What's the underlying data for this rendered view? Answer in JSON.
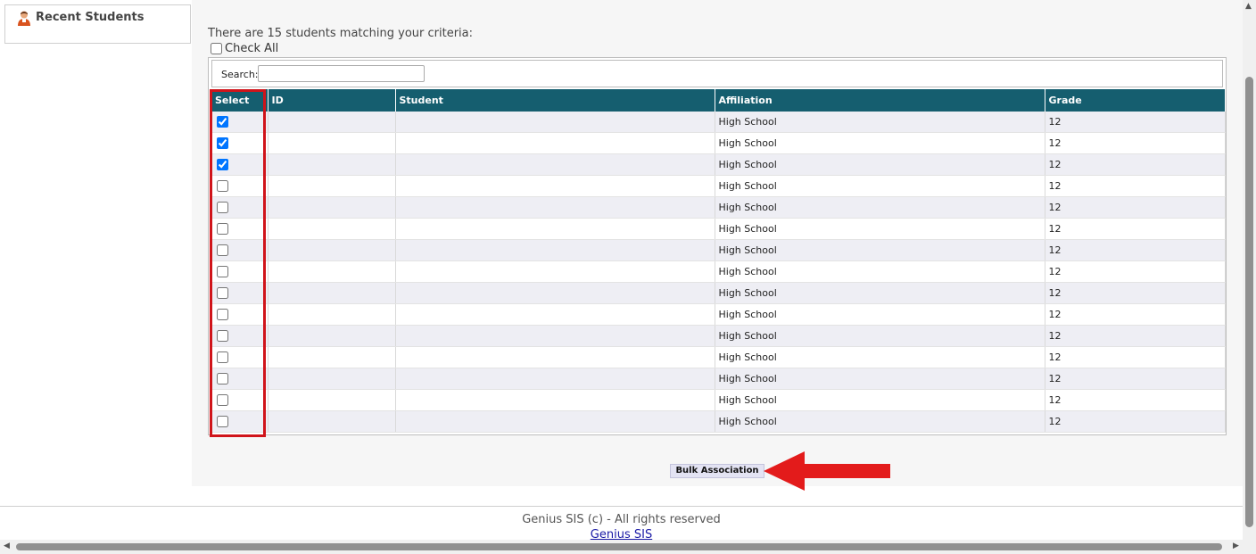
{
  "sidebar": {
    "recent_title": "Recent Students",
    "icon": "student-avatar-icon"
  },
  "main": {
    "match_text": "There are 15 students matching your criteria:",
    "check_all_label": "Check All",
    "search_label": "Search:",
    "search_value": ""
  },
  "table": {
    "columns": [
      "Select",
      "ID",
      "Student",
      "Affiliation",
      "Grade"
    ],
    "rows": [
      {
        "checked": true,
        "id": "",
        "student": "",
        "affiliation": "High School",
        "grade": "12"
      },
      {
        "checked": true,
        "id": "",
        "student": "",
        "affiliation": "High School",
        "grade": "12"
      },
      {
        "checked": true,
        "id": "",
        "student": "",
        "affiliation": "High School",
        "grade": "12"
      },
      {
        "checked": false,
        "id": "",
        "student": "",
        "affiliation": "High School",
        "grade": "12"
      },
      {
        "checked": false,
        "id": "",
        "student": "",
        "affiliation": "High School",
        "grade": "12"
      },
      {
        "checked": false,
        "id": "",
        "student": "",
        "affiliation": "High School",
        "grade": "12"
      },
      {
        "checked": false,
        "id": "",
        "student": "",
        "affiliation": "High School",
        "grade": "12"
      },
      {
        "checked": false,
        "id": "",
        "student": "",
        "affiliation": "High School",
        "grade": "12"
      },
      {
        "checked": false,
        "id": "",
        "student": "",
        "affiliation": "High School",
        "grade": "12"
      },
      {
        "checked": false,
        "id": "",
        "student": "",
        "affiliation": "High School",
        "grade": "12"
      },
      {
        "checked": false,
        "id": "",
        "student": "",
        "affiliation": "High School",
        "grade": "12"
      },
      {
        "checked": false,
        "id": "",
        "student": "",
        "affiliation": "High School",
        "grade": "12"
      },
      {
        "checked": false,
        "id": "",
        "student": "",
        "affiliation": "High School",
        "grade": "12"
      },
      {
        "checked": false,
        "id": "",
        "student": "",
        "affiliation": "High School",
        "grade": "12"
      },
      {
        "checked": false,
        "id": "",
        "student": "",
        "affiliation": "High School",
        "grade": "12"
      }
    ]
  },
  "actions": {
    "bulk_label": "Bulk Association"
  },
  "annotation": {
    "highlight_color": "#d0141a",
    "arrow_color": "#e31b1b"
  },
  "footer": {
    "copyright": "Genius SIS (c) - All rights reserved",
    "link_text": "Genius SIS"
  },
  "colors": {
    "header_bg": "#155e6f"
  }
}
